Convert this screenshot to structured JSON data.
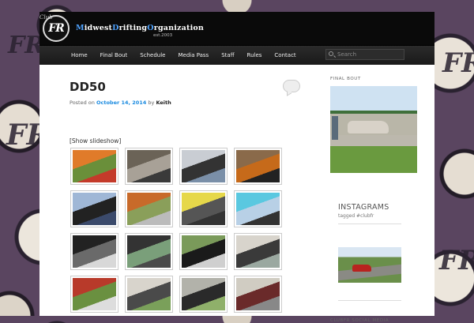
{
  "site": {
    "title_parts": [
      {
        "text": "M",
        "hl": true
      },
      {
        "text": "idwest",
        "hl": false
      },
      {
        "text": "D",
        "hl": true
      },
      {
        "text": "rifting",
        "hl": false
      },
      {
        "text": "O",
        "hl": true
      },
      {
        "text": "rganization",
        "hl": false
      }
    ],
    "est": "est.2003",
    "logo_text": "FR",
    "logo_club": "Club"
  },
  "nav": {
    "items": [
      "Home",
      "Final Bout",
      "Schedule",
      "Media Pass",
      "Staff",
      "Rules",
      "Contact"
    ]
  },
  "search": {
    "placeholder": "Search"
  },
  "post": {
    "title": "DD50",
    "posted_on": "Posted on",
    "date": "October 14, 2014",
    "by": "by",
    "author": "Keith",
    "slideshow_label": "[Show slideshow]"
  },
  "gallery": {
    "thumbs": [
      "autumn trees, red car",
      "spectators walking",
      "person in jacket",
      "person in orange jacket",
      "",
      "person in jeans by trailer",
      "cars under autumn trees",
      "yellow car on trailer",
      "cyan car on trailer",
      "",
      "group of people",
      "group by cars",
      "drifting car on track",
      "drifting car smoke",
      "",
      "red car drifting",
      "white car drifting",
      "car on track",
      "car with smoke",
      ""
    ]
  },
  "sidebar": {
    "final_bout_title": "FINAL BOUT",
    "insta_title": "INSTAGRAMS",
    "insta_tag": "tagged #clubfr",
    "social_title": "CLUBFR SOCIAL MEDIA"
  },
  "colors": {
    "accent": "#1b8be0",
    "header_bg": "#0a0a0a",
    "nav_bg": "#222222"
  }
}
